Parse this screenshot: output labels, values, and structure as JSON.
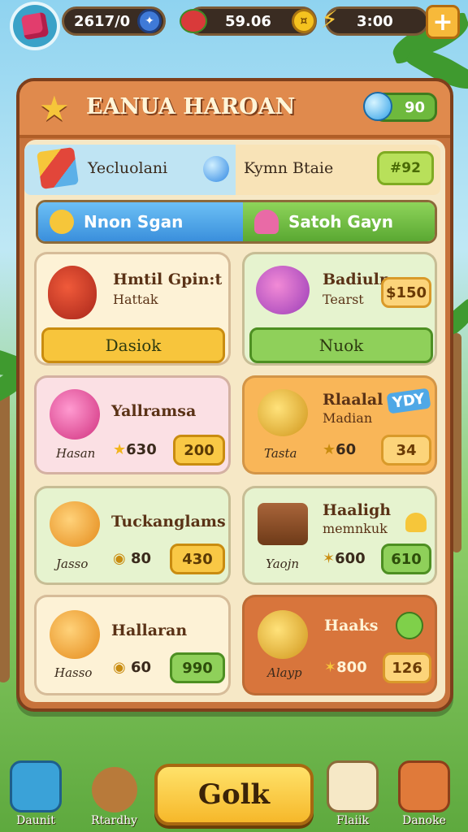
{
  "topbar": {
    "score": "2617/0",
    "coins": "59.06",
    "time": "3:00",
    "plus_label": "+"
  },
  "panel": {
    "title": "EANUA HAROAN",
    "gems": "90"
  },
  "info": {
    "left_label": "Yecluolani",
    "right_label": "Kymn Btaie",
    "badge": "#92"
  },
  "tabs": [
    {
      "label": "Nnon Sgan"
    },
    {
      "label": "Satoh Gayn"
    }
  ],
  "featured": [
    {
      "name": "Hmtil Gpin:t",
      "sub": "Hattak",
      "button": "Dasiok"
    },
    {
      "name": "Badiuln",
      "sub": "Tearst",
      "price": "$150",
      "button": "Nuok"
    }
  ],
  "items": [
    {
      "name": "Yallramsa",
      "small": "Hasan",
      "cost": "630",
      "price": "200"
    },
    {
      "name": "Rlaalal",
      "sub": "Madian",
      "tag": "YDY",
      "small": "Tasta",
      "cost": "60",
      "price": "34"
    },
    {
      "name": "Tuckanglams",
      "small": "Jasso",
      "cost": "80",
      "price": "430"
    },
    {
      "name": "Haaligh",
      "sub": "memnkuk",
      "small": "Yaojn",
      "cost": "600",
      "price": "610"
    },
    {
      "name": "Hallaran",
      "small": "Hasso",
      "cost": "60",
      "price": "990"
    },
    {
      "name": "Haaks",
      "small": "Alayp",
      "cost": "800",
      "price": "126"
    }
  ],
  "bottom": {
    "left1": "Daunit",
    "left2": "Rtardhy",
    "main": "Golk",
    "right1": "Flaiik",
    "right2": "Danoke"
  },
  "colors": {
    "panel": "#c7733c",
    "header": "#e08a4d",
    "tab_blue": "#4aa6e8",
    "tab_green": "#6ebd3c"
  }
}
